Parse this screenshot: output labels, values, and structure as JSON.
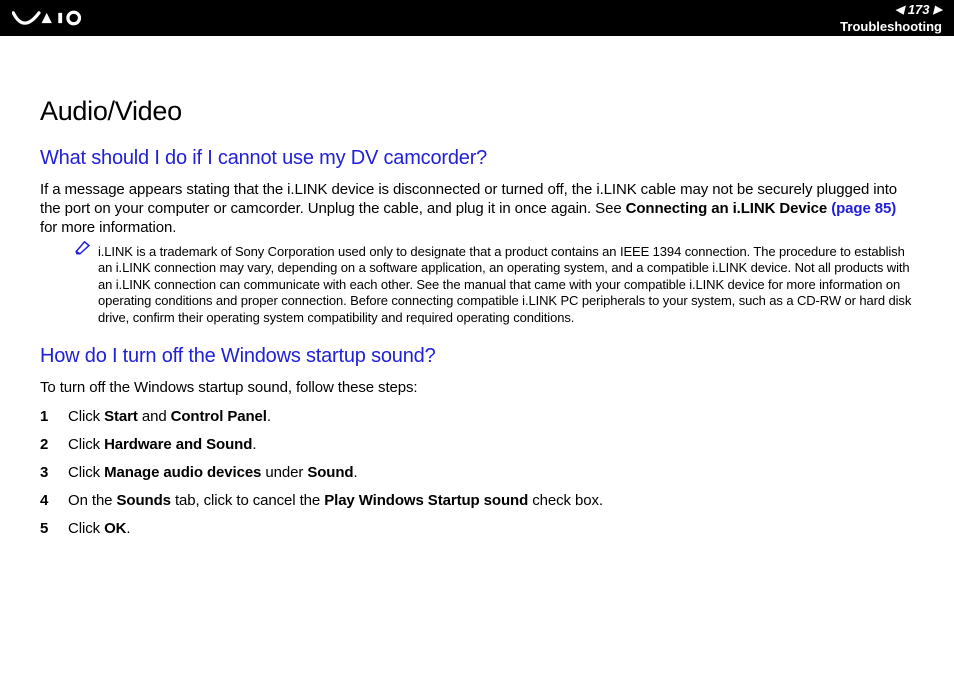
{
  "header": {
    "page_number": "173",
    "section": "Troubleshooting"
  },
  "content": {
    "section_title": "Audio/Video",
    "q1": {
      "title": "What should I do if I cannot use my DV camcorder?",
      "p1_a": "If a message appears stating that the i.LINK device is disconnected or turned off, the i.LINK cable may not be securely plugged into the port on your computer or camcorder. Unplug the cable, and plug it in once again. See ",
      "p1_bold": "Connecting an i.LINK Device ",
      "p1_ref": "(page 85)",
      "p1_b": " for more information.",
      "note": "i.LINK is a trademark of Sony Corporation used only to designate that a product contains an IEEE 1394 connection. The procedure to establish an i.LINK connection may vary, depending on a software application, an operating system, and a compatible i.LINK device. Not all products with an i.LINK connection can communicate with each other. See the manual that came with your compatible i.LINK device for more information on operating conditions and proper connection. Before connecting compatible i.LINK PC peripherals to your system, such as a CD-RW or hard disk drive, confirm their operating system compatibility and required operating conditions."
    },
    "q2": {
      "title": "How do I turn off the Windows startup sound?",
      "intro": "To turn off the Windows startup sound, follow these steps:",
      "steps": [
        {
          "n": "1",
          "pre": "Click ",
          "b1": "Start",
          "mid": " and ",
          "b2": "Control Panel",
          "post": "."
        },
        {
          "n": "2",
          "pre": "Click ",
          "b1": "Hardware and Sound",
          "mid": "",
          "b2": "",
          "post": "."
        },
        {
          "n": "3",
          "pre": "Click ",
          "b1": "Manage audio devices",
          "mid": " under ",
          "b2": "Sound",
          "post": "."
        },
        {
          "n": "4",
          "pre": "On the ",
          "b1": "Sounds",
          "mid": " tab, click to cancel the ",
          "b2": "Play Windows Startup sound",
          "post": " check box."
        },
        {
          "n": "5",
          "pre": "Click ",
          "b1": "OK",
          "mid": "",
          "b2": "",
          "post": "."
        }
      ]
    }
  }
}
